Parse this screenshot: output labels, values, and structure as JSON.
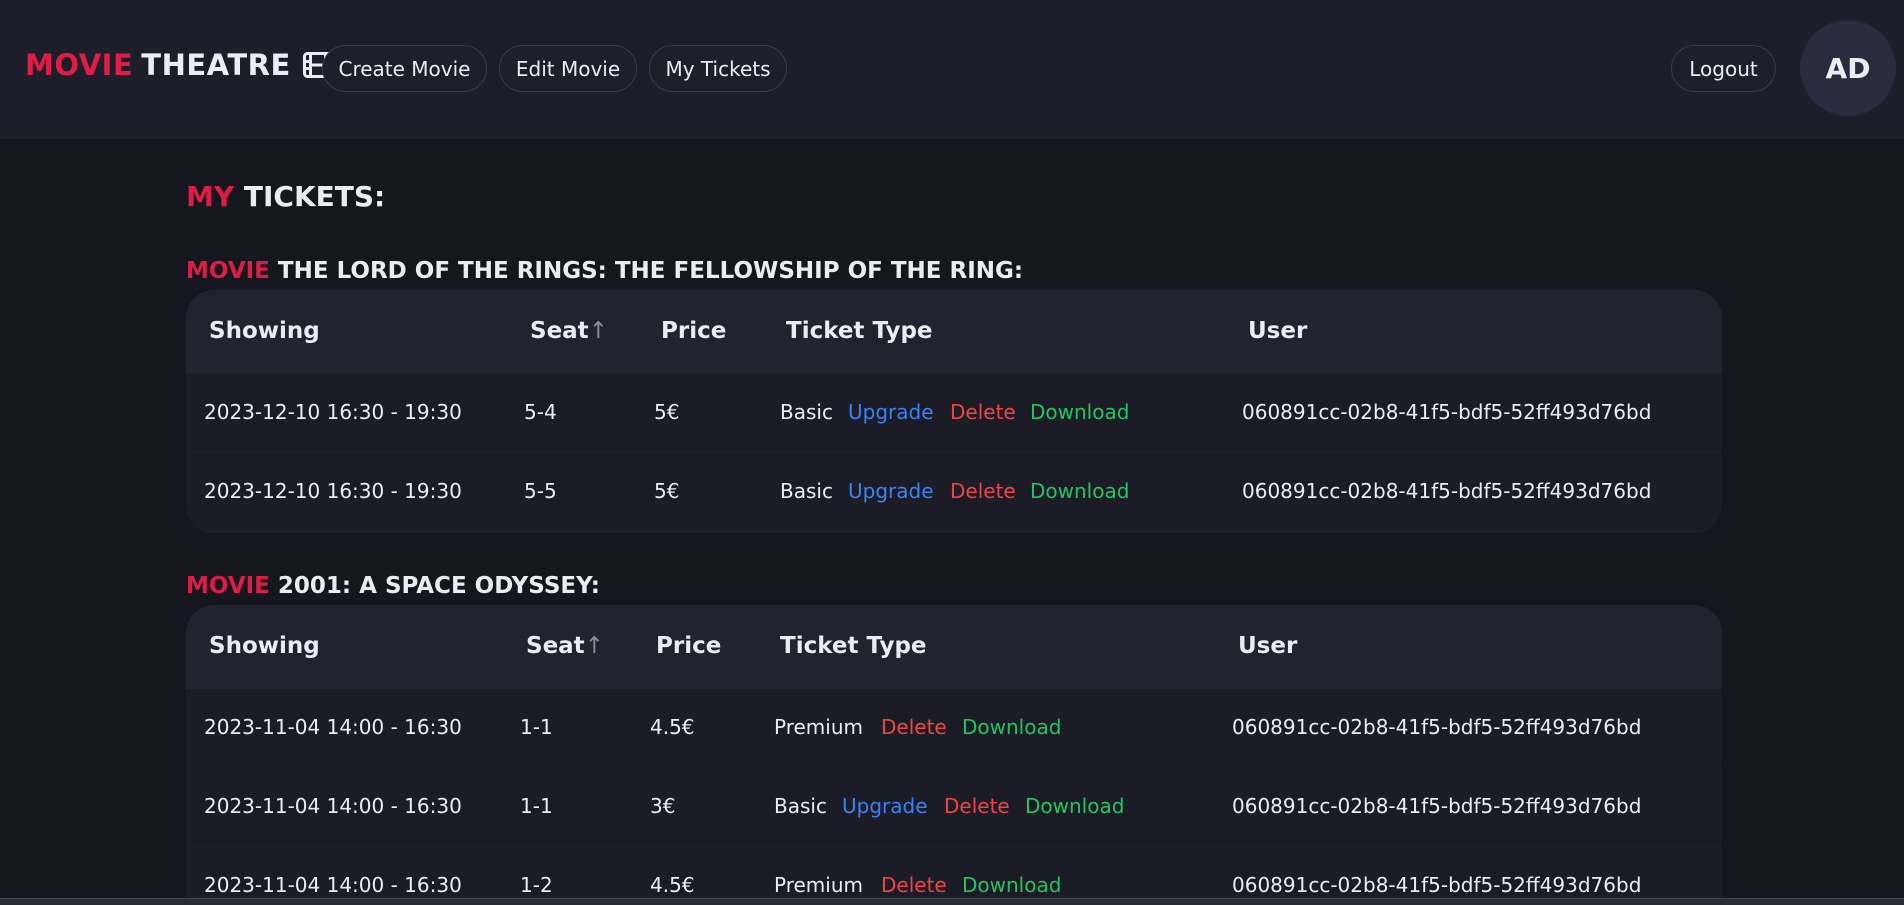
{
  "header": {
    "logo_accent": "MOVIE",
    "logo_rest": "THEATRE",
    "logo_icon": "film-icon",
    "nav": {
      "create_movie": "Create Movie",
      "edit_movie": "Edit Movie",
      "my_tickets": "My Tickets"
    },
    "logout": "Logout",
    "avatar_initials": "AD"
  },
  "page": {
    "title_accent": "MY",
    "title_rest": "TICKETS:"
  },
  "columns": {
    "showing": "Showing",
    "seat": "Seat",
    "sort_indicator": "↑",
    "price": "Price",
    "ticket_type": "Ticket Type",
    "user": "User"
  },
  "actions": {
    "upgrade": "Upgrade",
    "delete": "Delete",
    "download": "Download"
  },
  "sections": [
    {
      "label": "MOVIE",
      "movie_title": "THE LORD OF THE RINGS: THE FELLOWSHIP OF THE RING:",
      "rows": [
        {
          "showing": "2023-12-10 16:30 - 19:30",
          "seat": "5-4",
          "price": "5€",
          "type": "Basic",
          "user": "060891cc-02b8-41f5-bdf5-52ff493d76bd"
        },
        {
          "showing": "2023-12-10 16:30 - 19:30",
          "seat": "5-5",
          "price": "5€",
          "type": "Basic",
          "user": "060891cc-02b8-41f5-bdf5-52ff493d76bd"
        }
      ]
    },
    {
      "label": "MOVIE",
      "movie_title": "2001: A SPACE ODYSSEY:",
      "rows": [
        {
          "showing": "2023-11-04 14:00 - 16:30",
          "seat": "1-1",
          "price": "4.5€",
          "type": "Premium",
          "user": "060891cc-02b8-41f5-bdf5-52ff493d76bd"
        },
        {
          "showing": "2023-11-04 14:00 - 16:30",
          "seat": "1-1",
          "price": "3€",
          "type": "Basic",
          "user": "060891cc-02b8-41f5-bdf5-52ff493d76bd"
        },
        {
          "showing": "2023-11-04 14:00 - 16:30",
          "seat": "1-2",
          "price": "4.5€",
          "type": "Premium",
          "user": "060891cc-02b8-41f5-bdf5-52ff493d76bd"
        }
      ]
    }
  ],
  "colors": {
    "accent": "#dc1e46",
    "upgrade": "#3b82f6",
    "delete": "#ef4444",
    "download": "#22c55e",
    "background": "#15161e"
  }
}
